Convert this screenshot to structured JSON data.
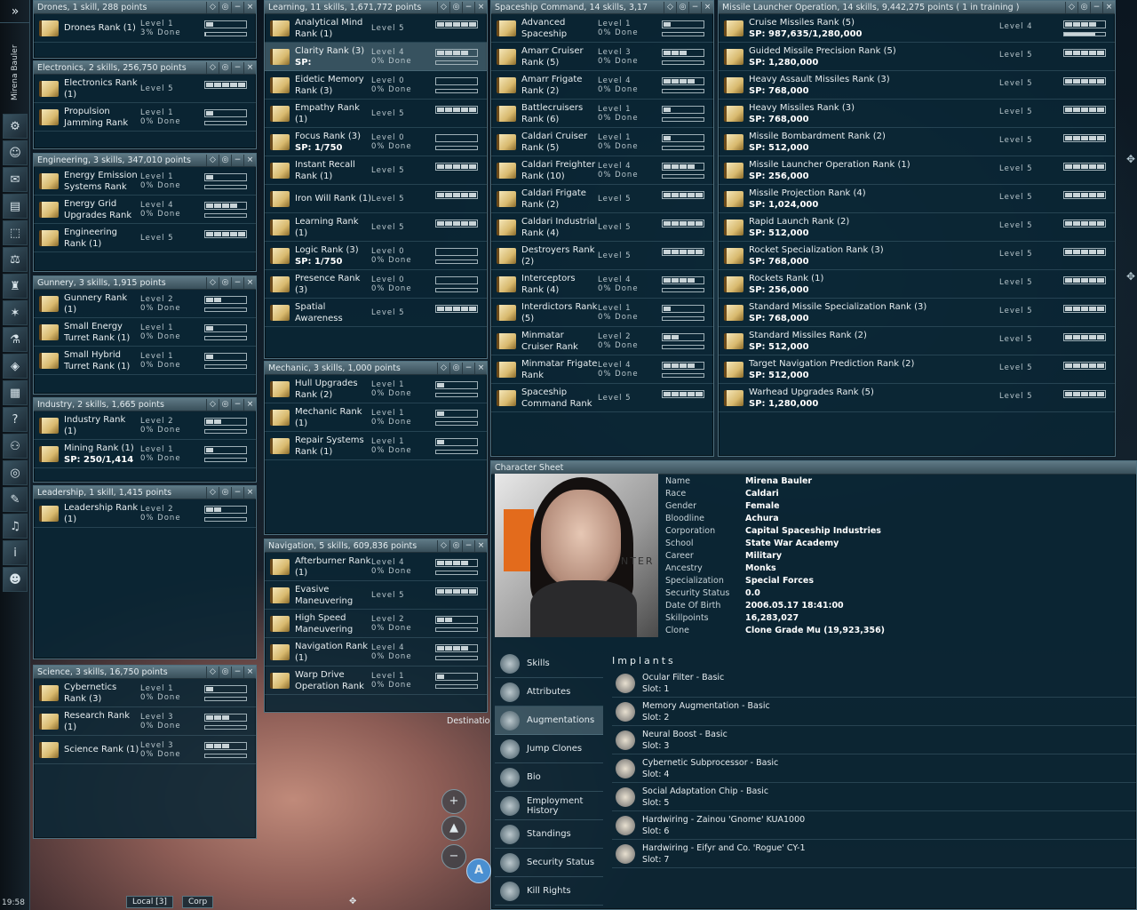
{
  "sidebar": {
    "expand_label": "»",
    "pilot_name": "Mirena Bauler",
    "time": "19:58",
    "icons": [
      "neocom-icon",
      "character-icon",
      "mail-icon",
      "notepad-icon",
      "assets-icon",
      "market-icon",
      "corp-icon",
      "map-icon",
      "science-icon",
      "fitting-icon",
      "calculator-icon",
      "help-icon",
      "people-icon",
      "scanner-icon",
      "journal-icon",
      "audio-icon",
      "info-icon",
      "portrait-icon"
    ]
  },
  "groups": {
    "drones": {
      "title": "Drones, 1 skill, 288 points",
      "skills": [
        {
          "name": "Drones Rank (1)",
          "level": "Level 1",
          "done": "3% Done",
          "lv": 1,
          "partial": 0.03
        }
      ]
    },
    "electronics": {
      "title": "Electronics, 2 skills, 256,750 points",
      "skills": [
        {
          "name": "Electronics Rank (1)",
          "level": "Level 5",
          "done": "",
          "lv": 5,
          "partial": 0
        },
        {
          "name": "Propulsion Jamming Rank",
          "level": "Level 1",
          "done": "0% Done",
          "lv": 1,
          "partial": 0
        }
      ]
    },
    "engineering": {
      "title": "Engineering, 3 skills, 347,010 points",
      "skills": [
        {
          "name": "Energy Emission Systems Rank",
          "level": "Level 1",
          "done": "0% Done",
          "lv": 1,
          "partial": 0
        },
        {
          "name": "Energy Grid Upgrades Rank",
          "level": "Level 4",
          "done": "0% Done",
          "lv": 4,
          "partial": 0
        },
        {
          "name": "Engineering Rank (1)",
          "level": "Level 5",
          "done": "",
          "lv": 5,
          "partial": 0
        }
      ]
    },
    "gunnery": {
      "title": "Gunnery, 3 skills, 1,915 points",
      "skills": [
        {
          "name": "Gunnery Rank (1)",
          "level": "Level 2",
          "done": "0% Done",
          "lv": 2,
          "partial": 0
        },
        {
          "name": "Small Energy Turret Rank (1)",
          "level": "Level 1",
          "done": "0% Done",
          "lv": 1,
          "partial": 0
        },
        {
          "name": "Small Hybrid Turret Rank (1)",
          "level": "Level 1",
          "done": "0% Done",
          "lv": 1,
          "partial": 0
        }
      ]
    },
    "industry": {
      "title": "Industry, 2 skills, 1,665 points",
      "skills": [
        {
          "name": "Industry Rank (1)",
          "level": "Level 2",
          "done": "0% Done",
          "lv": 2,
          "partial": 0
        },
        {
          "name": "Mining Rank (1)",
          "sp": "SP: 250/1,414",
          "level": "Level 1",
          "done": "0% Done",
          "lv": 1,
          "partial": 0
        }
      ]
    },
    "leadership": {
      "title": "Leadership, 1 skill, 1,415 points",
      "skills": [
        {
          "name": "Leadership Rank (1)",
          "level": "Level 2",
          "done": "0% Done",
          "lv": 2,
          "partial": 0
        }
      ]
    },
    "science": {
      "title": "Science, 3 skills, 16,750 points",
      "skills": [
        {
          "name": "Cybernetics Rank (3)",
          "level": "Level 1",
          "done": "0% Done",
          "lv": 1,
          "partial": 0
        },
        {
          "name": "Research Rank (1)",
          "level": "Level 3",
          "done": "0% Done",
          "lv": 3,
          "partial": 0
        },
        {
          "name": "Science Rank (1)",
          "level": "Level 3",
          "done": "0% Done",
          "lv": 3,
          "partial": 0
        }
      ]
    },
    "learning": {
      "title": "Learning, 11 skills, 1,671,772 points",
      "skills": [
        {
          "name": "Analytical Mind Rank (1)",
          "level": "Level 5",
          "done": "",
          "lv": 5,
          "partial": 0
        },
        {
          "name": "Clarity Rank (3)",
          "sp": "SP:",
          "level": "Level 4",
          "done": "0% Done",
          "lv": 4,
          "partial": 0,
          "selected": true
        },
        {
          "name": "Eidetic Memory Rank (3)",
          "level": "Level 0",
          "done": "0% Done",
          "lv": 0,
          "partial": 0
        },
        {
          "name": "Empathy Rank (1)",
          "level": "Level 5",
          "done": "",
          "lv": 5,
          "partial": 0
        },
        {
          "name": "Focus Rank (3)",
          "sp": "SP: 1/750",
          "level": "Level 0",
          "done": "0% Done",
          "lv": 0,
          "partial": 0
        },
        {
          "name": "Instant Recall Rank (1)",
          "level": "Level 5",
          "done": "",
          "lv": 5,
          "partial": 0
        },
        {
          "name": "Iron Will Rank (1)",
          "level": "Level 5",
          "done": "",
          "lv": 5,
          "partial": 0
        },
        {
          "name": "Learning Rank (1)",
          "level": "Level 5",
          "done": "",
          "lv": 5,
          "partial": 0
        },
        {
          "name": "Logic Rank (3)",
          "sp": "SP: 1/750",
          "level": "Level 0",
          "done": "0% Done",
          "lv": 0,
          "partial": 0
        },
        {
          "name": "Presence Rank (3)",
          "level": "Level 0",
          "done": "0% Done",
          "lv": 0,
          "partial": 0
        },
        {
          "name": "Spatial Awareness",
          "level": "Level 5",
          "done": "",
          "lv": 5,
          "partial": 0
        }
      ]
    },
    "mechanic": {
      "title": "Mechanic, 3 skills, 1,000 points",
      "skills": [
        {
          "name": "Hull Upgrades Rank (2)",
          "level": "Level 1",
          "done": "0% Done",
          "lv": 1,
          "partial": 0
        },
        {
          "name": "Mechanic Rank (1)",
          "level": "Level 1",
          "done": "0% Done",
          "lv": 1,
          "partial": 0
        },
        {
          "name": "Repair Systems Rank (1)",
          "level": "Level 1",
          "done": "0% Done",
          "lv": 1,
          "partial": 0
        }
      ]
    },
    "navigation": {
      "title": "Navigation, 5 skills, 609,836 points",
      "skills": [
        {
          "name": "Afterburner Rank (1)",
          "level": "Level 4",
          "done": "0% Done",
          "lv": 4,
          "partial": 0
        },
        {
          "name": "Evasive Maneuvering",
          "level": "Level 5",
          "done": "",
          "lv": 5,
          "partial": 0
        },
        {
          "name": "High Speed Maneuvering",
          "level": "Level 2",
          "done": "0% Done",
          "lv": 2,
          "partial": 0
        },
        {
          "name": "Navigation Rank (1)",
          "level": "Level 4",
          "done": "0% Done",
          "lv": 4,
          "partial": 0
        },
        {
          "name": "Warp Drive Operation Rank",
          "level": "Level 1",
          "done": "0% Done",
          "lv": 1,
          "partial": 0
        }
      ]
    },
    "spaceship": {
      "title": "Spaceship Command, 14 skills, 3,17",
      "skills": [
        {
          "name": "Advanced Spaceship",
          "level": "Level 1",
          "done": "0% Done",
          "lv": 1,
          "partial": 0
        },
        {
          "name": "Amarr Cruiser Rank (5)",
          "level": "Level 3",
          "done": "0% Done",
          "lv": 3,
          "partial": 0
        },
        {
          "name": "Amarr Frigate Rank (2)",
          "level": "Level 4",
          "done": "0% Done",
          "lv": 4,
          "partial": 0
        },
        {
          "name": "Battlecruisers Rank (6)",
          "level": "Level 1",
          "done": "0% Done",
          "lv": 1,
          "partial": 0
        },
        {
          "name": "Caldari Cruiser Rank (5)",
          "level": "Level 1",
          "done": "0% Done",
          "lv": 1,
          "partial": 0
        },
        {
          "name": "Caldari Freighter Rank (10)",
          "level": "Level 4",
          "done": "0% Done",
          "lv": 4,
          "partial": 0
        },
        {
          "name": "Caldari Frigate Rank (2)",
          "level": "Level 5",
          "done": "",
          "lv": 5,
          "partial": 0
        },
        {
          "name": "Caldari Industrial Rank (4)",
          "level": "Level 5",
          "done": "",
          "lv": 5,
          "partial": 0
        },
        {
          "name": "Destroyers Rank (2)",
          "level": "Level 5",
          "done": "",
          "lv": 5,
          "partial": 0
        },
        {
          "name": "Interceptors Rank (4)",
          "level": "Level 4",
          "done": "0% Done",
          "lv": 4,
          "partial": 0
        },
        {
          "name": "Interdictors Rank (5)",
          "level": "Level 1",
          "done": "0% Done",
          "lv": 1,
          "partial": 0
        },
        {
          "name": "Minmatar Cruiser Rank",
          "level": "Level 2",
          "done": "0% Done",
          "lv": 2,
          "partial": 0
        },
        {
          "name": "Minmatar Frigate Rank",
          "level": "Level 4",
          "done": "0% Done",
          "lv": 4,
          "partial": 0
        },
        {
          "name": "Spaceship Command Rank",
          "level": "Level 5",
          "done": "",
          "lv": 5,
          "partial": 0
        }
      ]
    },
    "missile": {
      "title": "Missile Launcher Operation, 14 skills, 9,442,275 points ( 1 in training )",
      "skills": [
        {
          "name": "Cruise Missiles Rank (5)",
          "sp": "SP: 987,635/1,280,000",
          "level": "Level 4",
          "done": "",
          "lv": 4,
          "partial": 0.77
        },
        {
          "name": "Guided Missile Precision Rank (5)",
          "sp": "SP: 1,280,000",
          "level": "Level 5",
          "done": "",
          "lv": 5,
          "partial": 0
        },
        {
          "name": "Heavy Assault Missiles Rank (3)",
          "sp": "SP: 768,000",
          "level": "Level 5",
          "done": "",
          "lv": 5,
          "partial": 0
        },
        {
          "name": "Heavy Missiles Rank (3)",
          "sp": "SP: 768,000",
          "level": "Level 5",
          "done": "",
          "lv": 5,
          "partial": 0
        },
        {
          "name": "Missile Bombardment Rank (2)",
          "sp": "SP: 512,000",
          "level": "Level 5",
          "done": "",
          "lv": 5,
          "partial": 0
        },
        {
          "name": "Missile Launcher Operation Rank (1)",
          "sp": "SP: 256,000",
          "level": "Level 5",
          "done": "",
          "lv": 5,
          "partial": 0
        },
        {
          "name": "Missile Projection Rank (4)",
          "sp": "SP: 1,024,000",
          "level": "Level 5",
          "done": "",
          "lv": 5,
          "partial": 0
        },
        {
          "name": "Rapid Launch Rank (2)",
          "sp": "SP: 512,000",
          "level": "Level 5",
          "done": "",
          "lv": 5,
          "partial": 0
        },
        {
          "name": "Rocket Specialization Rank (3)",
          "sp": "SP: 768,000",
          "level": "Level 5",
          "done": "",
          "lv": 5,
          "partial": 0
        },
        {
          "name": "Rockets Rank (1)",
          "sp": "SP: 256,000",
          "level": "Level 5",
          "done": "",
          "lv": 5,
          "partial": 0
        },
        {
          "name": "Standard Missile Specialization Rank (3)",
          "sp": "SP: 768,000",
          "level": "Level 5",
          "done": "",
          "lv": 5,
          "partial": 0
        },
        {
          "name": "Standard Missiles Rank (2)",
          "sp": "SP: 512,000",
          "level": "Level 5",
          "done": "",
          "lv": 5,
          "partial": 0
        },
        {
          "name": "Target Navigation Prediction Rank (2)",
          "sp": "SP: 512,000",
          "level": "Level 5",
          "done": "",
          "lv": 5,
          "partial": 0
        },
        {
          "name": "Warhead Upgrades Rank (5)",
          "sp": "SP: 1,280,000",
          "level": "Level 5",
          "done": "",
          "lv": 5,
          "partial": 0
        }
      ]
    }
  },
  "character_sheet": {
    "title": "Character Sheet",
    "photo_text": "NTER",
    "fields": [
      {
        "k": "Name",
        "v": "Mirena Bauler"
      },
      {
        "k": "Race",
        "v": "Caldari"
      },
      {
        "k": "Gender",
        "v": "Female"
      },
      {
        "k": "Bloodline",
        "v": "Achura"
      },
      {
        "k": "Corporation",
        "v": "Capital Spaceship Industries"
      },
      {
        "k": "School",
        "v": "State War Academy"
      },
      {
        "k": "Career",
        "v": "Military"
      },
      {
        "k": "Ancestry",
        "v": "Monks"
      },
      {
        "k": "Specialization",
        "v": "Special Forces"
      },
      {
        "k": "Security Status",
        "v": "0.0"
      },
      {
        "k": "Date Of Birth",
        "v": "2006.05.17 18:41:00"
      },
      {
        "k": "Skillpoints",
        "v": "16,283,027"
      },
      {
        "k": "Clone",
        "v": "Clone Grade Mu (19,923,356)"
      }
    ],
    "tabs": [
      "Skills",
      "Attributes",
      "Augmentations",
      "Jump Clones",
      "Bio",
      "Employment History",
      "Standings",
      "Security Status",
      "Kill Rights"
    ],
    "active_tab": "Augmentations",
    "implants_heading": "Implants",
    "implants": [
      {
        "name": "Ocular Filter - Basic",
        "slot": "Slot: 1"
      },
      {
        "name": "Memory Augmentation - Basic",
        "slot": "Slot: 2"
      },
      {
        "name": "Neural Boost - Basic",
        "slot": "Slot: 3"
      },
      {
        "name": "Cybernetic Subprocessor - Basic",
        "slot": "Slot: 4"
      },
      {
        "name": "Social Adaptation Chip - Basic",
        "slot": "Slot: 5"
      },
      {
        "name": "Hardwiring - Zainou 'Gnome' KUA1000",
        "slot": "Slot: 6"
      },
      {
        "name": "Hardwiring - Eifyr and Co. 'Rogue' CY-1",
        "slot": "Slot: 7"
      }
    ]
  },
  "space": {
    "destination_label": "Destinatio",
    "hud_buttons": [
      "+",
      "▲",
      "−",
      "A"
    ],
    "chat_tabs": [
      "Local [3]",
      "Corp"
    ]
  }
}
